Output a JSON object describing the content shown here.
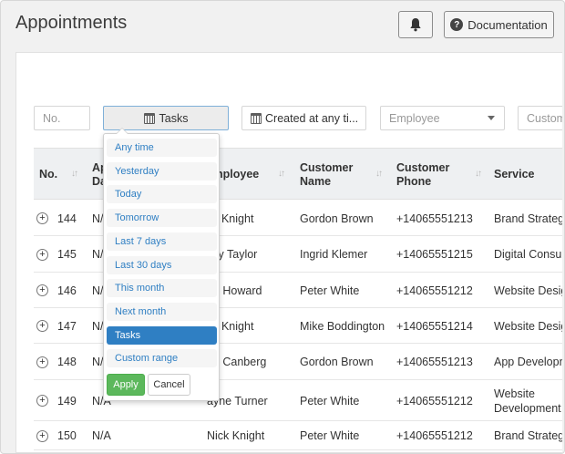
{
  "header": {
    "title": "Appointments",
    "bell_icon": "bell-icon",
    "documentation_label": "Documentation",
    "question_icon_glyph": "?"
  },
  "filters": {
    "no_placeholder": "No.",
    "tasks_label": "Tasks",
    "created_label": "Created at any ti...",
    "employee_placeholder": "Employee",
    "customer_placeholder": "Custom"
  },
  "table": {
    "columns": [
      {
        "label": "No."
      },
      {
        "label": "Ap",
        "label2": "Da"
      },
      {
        "label": "nployee"
      },
      {
        "label": "Customer",
        "label2": "Name"
      },
      {
        "label": "Customer",
        "label2": "Phone"
      },
      {
        "label": "Service"
      }
    ],
    "rows": [
      {
        "no": "144",
        "date": "N/A",
        "employee": "ck Knight",
        "customer": "Gordon Brown",
        "phone": "+14065551213",
        "service": "Brand Strateg",
        "service2": ""
      },
      {
        "no": "145",
        "date": "N/A",
        "employee": "nily Taylor",
        "customer": "Ingrid Klemer",
        "phone": "+14065551215",
        "service": "Digital Consu",
        "service2": ""
      },
      {
        "no": "146",
        "date": "N/A",
        "employee": "ne Howard",
        "customer": "Peter White",
        "phone": "+14065551212",
        "service": "Website Desig",
        "service2": ""
      },
      {
        "no": "147",
        "date": "N/A",
        "employee": "ck Knight",
        "customer": "Mike Boddington",
        "phone": "+14065551214",
        "service": "Website Desig",
        "service2": ""
      },
      {
        "no": "148",
        "date": "N/A",
        "employee": "gh Canberg",
        "customer": "Gordon Brown",
        "phone": "+14065551213",
        "service": "App Developn",
        "service2": ""
      },
      {
        "no": "149",
        "date": "N/A",
        "employee": "ayne Turner",
        "customer": "Peter White",
        "phone": "+14065551212",
        "service": "Website",
        "service2": "Development"
      },
      {
        "no": "150",
        "date": "N/A",
        "employee": "Nick Knight",
        "customer": "Peter White",
        "phone": "+14065551212",
        "service": "Brand Strateg",
        "service2": ""
      }
    ]
  },
  "dropdown": {
    "ranges": [
      "Any time",
      "Yesterday",
      "Today",
      "Tomorrow",
      "Last 7 days",
      "Last 30 days",
      "This month",
      "Next month",
      "Tasks",
      "Custom range"
    ],
    "active_index": 8,
    "apply_label": "Apply",
    "cancel_label": "Cancel"
  },
  "colors": {
    "accent": "#2f7fc3",
    "apply_green": "#5cb85c",
    "header_bg": "#eef0f2"
  }
}
